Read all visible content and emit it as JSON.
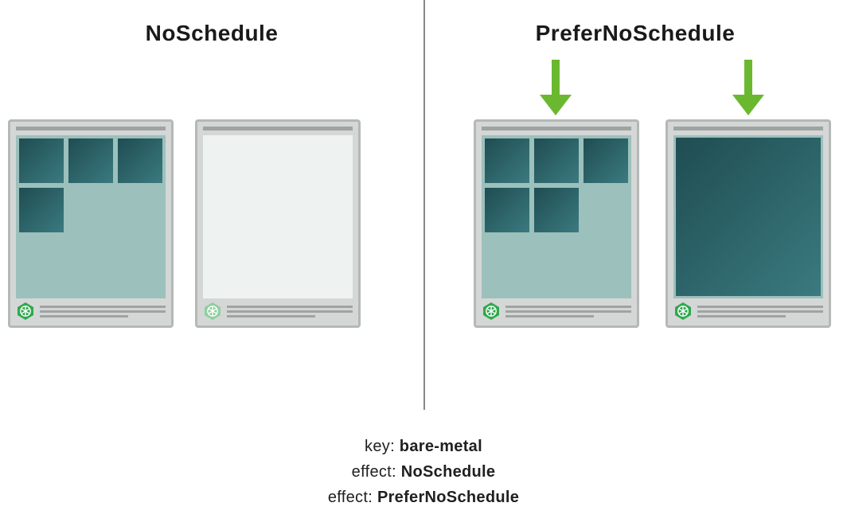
{
  "left": {
    "heading": "NoSchedule"
  },
  "right": {
    "heading": "PreferNoSchedule"
  },
  "nodes": {
    "left_active_pods": 4,
    "left_empty_pods": 0,
    "right_small_pods": 5,
    "right_big_pod": true
  },
  "params": {
    "line1_label": "key",
    "line1_value": "bare-metal",
    "line2_label": "effect",
    "line2_value": "NoSchedule",
    "line3_label": "effect",
    "line3_value": "PreferNoSchedule"
  },
  "icons": {
    "k8s": "kubernetes-icon"
  },
  "colors": {
    "arrow": "#6ab82f",
    "pod_dark": "#1f4d52",
    "node_border": "#b4b8b7",
    "node_bg": "#d4d7d6",
    "content_filled": "#9cc0bc",
    "content_empty": "#eef2f0"
  }
}
